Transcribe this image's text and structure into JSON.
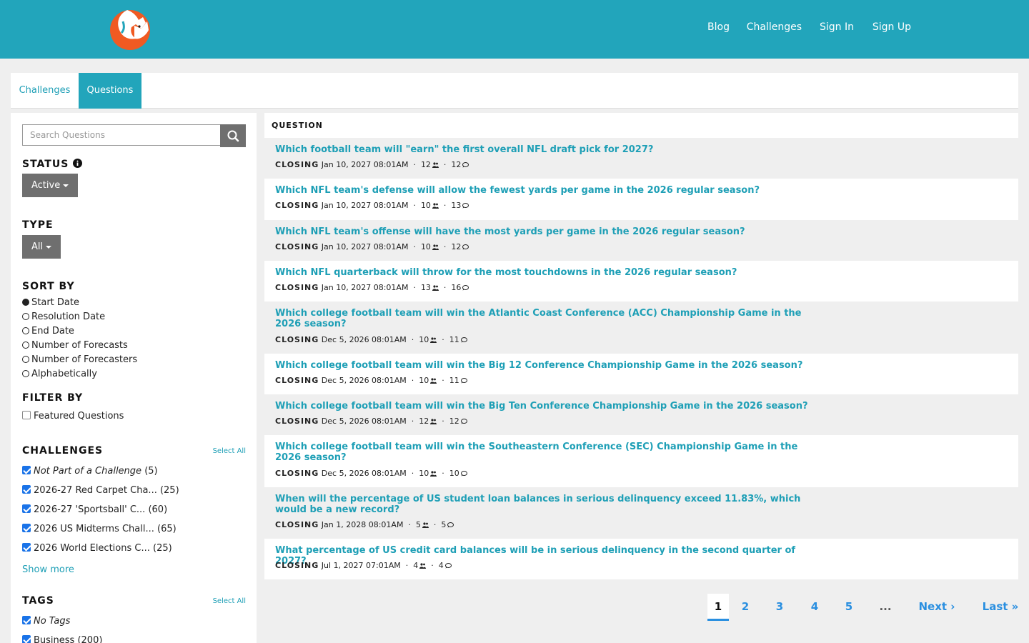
{
  "nav": {
    "blog": "Blog",
    "challenges": "Challenges",
    "sign_in": "Sign In",
    "sign_up": "Sign Up"
  },
  "tabs": {
    "challenges": "Challenges",
    "questions": "Questions"
  },
  "sidebar": {
    "search_placeholder": "Search Questions",
    "status_label": "STATUS",
    "status_value": "Active",
    "type_label": "TYPE",
    "type_value": "All",
    "sort_label": "SORT BY",
    "sort_options": [
      "Start Date",
      "Resolution Date",
      "End Date",
      "Number of Forecasts",
      "Number of Forecasters",
      "Alphabetically"
    ],
    "sort_selected": "Start Date",
    "filter_label": "FILTER BY",
    "featured": "Featured Questions",
    "challenges_label": "CHALLENGES",
    "select_all": "Select All",
    "challenge_items": [
      {
        "label": "Not Part of a Challenge",
        "count": "(5)"
      },
      {
        "label": "2026-27 Red Carpet Cha...",
        "count": "(25)"
      },
      {
        "label": "2026-27 'Sportsball' C...",
        "count": "(60)"
      },
      {
        "label": "2026 US Midterms Chall...",
        "count": "(65)"
      },
      {
        "label": "2026 World Elections C...",
        "count": "(25)"
      }
    ],
    "show_more": "Show more",
    "tags_label": "TAGS",
    "tag_items": [
      {
        "label": "No Tags",
        "count": ""
      },
      {
        "label": "Business",
        "count": "(200)"
      }
    ]
  },
  "questions": {
    "header": "QUESTION",
    "closing_label": "CLOSING",
    "items": [
      {
        "title": "Which football team will \"earn\" the first overall NFL draft pick for 2027?",
        "date": "Jan 10, 2027 08:01AM",
        "forecasters": "12",
        "comments": "12"
      },
      {
        "title": "Which NFL team's defense will allow the fewest yards per game in the 2026 regular season?",
        "date": "Jan 10, 2027 08:01AM",
        "forecasters": "10",
        "comments": "13"
      },
      {
        "title": "Which NFL team's offense will have the most yards per game in the 2026 regular season?",
        "date": "Jan 10, 2027 08:01AM",
        "forecasters": "10",
        "comments": "12"
      },
      {
        "title": "Which NFL quarterback will throw for the most touchdowns in the 2026 regular season?",
        "date": "Jan 10, 2027 08:01AM",
        "forecasters": "13",
        "comments": "16"
      },
      {
        "title": "Which college football team will win the Atlantic Coast Conference (ACC) Championship Game in the 2026 season?",
        "date": "Dec 5, 2026 08:01AM",
        "forecasters": "10",
        "comments": "11"
      },
      {
        "title": "Which college football team will win the Big 12 Conference Championship Game in the 2026 season?",
        "date": "Dec 5, 2026 08:01AM",
        "forecasters": "10",
        "comments": "11"
      },
      {
        "title": "Which college football team will win the Big Ten Conference Championship Game in the 2026 season?",
        "date": "Dec 5, 2026 08:01AM",
        "forecasters": "12",
        "comments": "12"
      },
      {
        "title": "Which college football team will win the Southeastern Conference (SEC) Championship Game in the 2026 season?",
        "date": "Dec 5, 2026 08:01AM",
        "forecasters": "10",
        "comments": "10"
      },
      {
        "title": "When will the percentage of US student loan balances in serious delinquency exceed 11.83%, which would be a new record?",
        "date": "Jan 1, 2028 08:01AM",
        "forecasters": "5",
        "comments": "5"
      },
      {
        "title": "What percentage of US credit card balances will be in serious delinquency in the second quarter of 2027?",
        "date": "Jul 1, 2027 07:01AM",
        "forecasters": "4",
        "comments": "4"
      }
    ]
  },
  "pagination": {
    "pages": [
      "1",
      "2",
      "3",
      "4",
      "5"
    ],
    "current": "1",
    "ellipsis": "...",
    "next": "Next ›",
    "last": "Last »"
  },
  "colors": {
    "brand": "#22a5bb",
    "link": "#1e9fb6",
    "pager": "#2a8fe0",
    "button": "#6f6f6f"
  },
  "icons": {
    "logo": "fox-logo",
    "search": "search-icon",
    "info": "info-icon",
    "forecasters": "users-icon",
    "comments": "comment-icon"
  }
}
